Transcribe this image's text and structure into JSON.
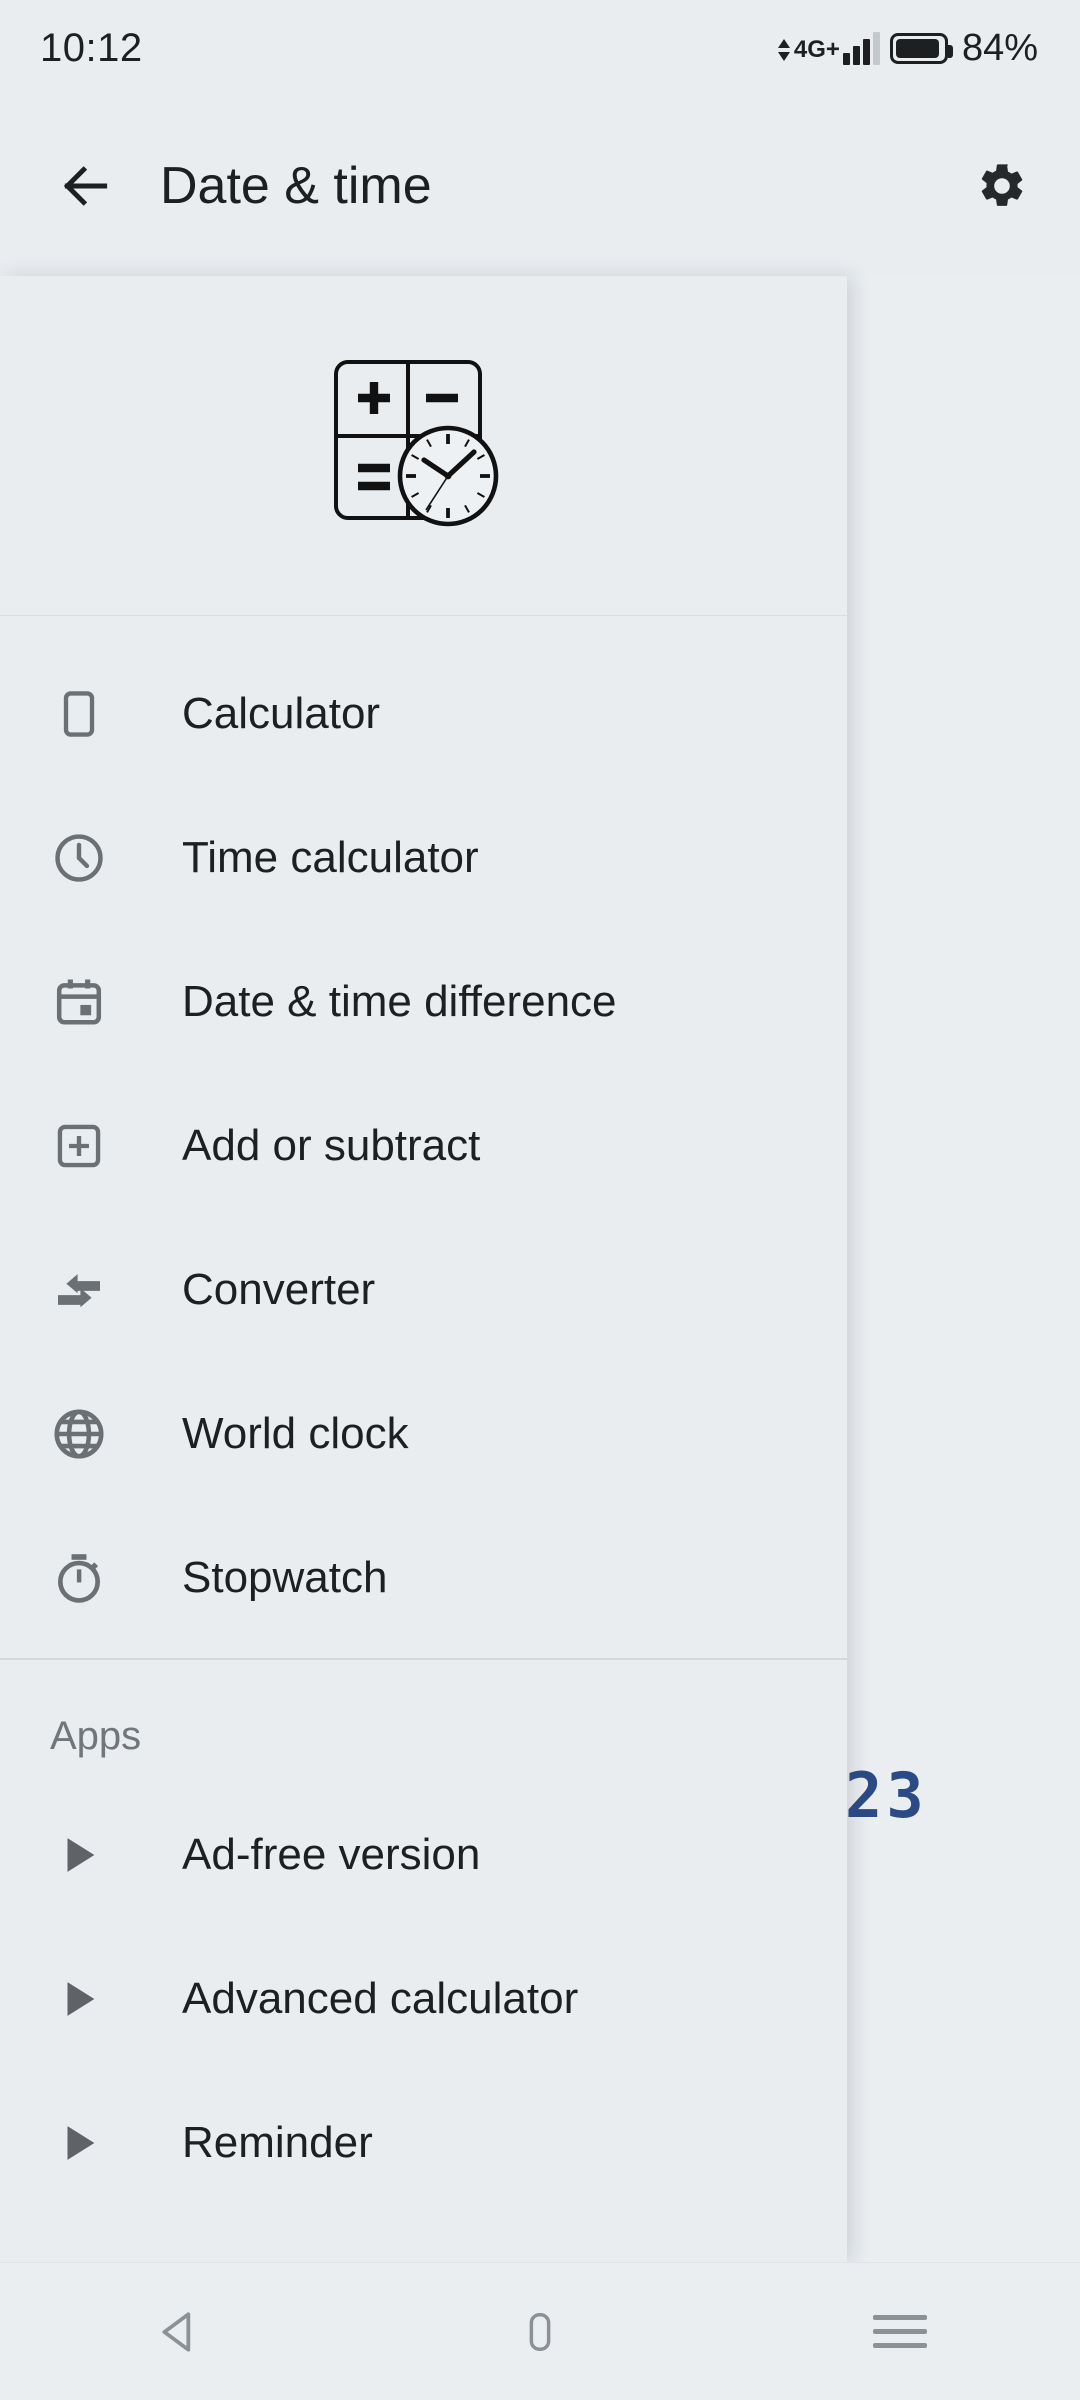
{
  "status_bar": {
    "clock": "10:12",
    "network_label": "4G+",
    "battery_percent": "84%",
    "battery_level": 84,
    "signal_bars": 3,
    "icons": [
      "data-updown-icon",
      "signal-bars-icon",
      "battery-icon"
    ]
  },
  "app_bar": {
    "back_icon": "arrow-left-icon",
    "title": "Date & time",
    "settings_icon": "gear-icon"
  },
  "drawer": {
    "logo_name": "calculator-clock-logo",
    "items": [
      {
        "label": "Calculator",
        "icon": "calculator-icon"
      },
      {
        "label": "Time calculator",
        "icon": "clock-icon"
      },
      {
        "label": "Date & time difference",
        "icon": "calendar-icon"
      },
      {
        "label": "Add or subtract",
        "icon": "plus-square-icon"
      },
      {
        "label": "Converter",
        "icon": "convert-arrows-icon"
      },
      {
        "label": "World clock",
        "icon": "globe-icon"
      },
      {
        "label": "Stopwatch",
        "icon": "stopwatch-icon"
      }
    ],
    "apps_section": {
      "header": "Apps",
      "items": [
        {
          "label": "Ad-free version",
          "icon": "play-triangle-icon"
        },
        {
          "label": "Advanced calculator",
          "icon": "play-triangle-icon"
        },
        {
          "label": "Reminder",
          "icon": "play-triangle-icon"
        }
      ]
    }
  },
  "background_screen": {
    "lcd_value": "23"
  },
  "system_nav": {
    "back_icon": "nav-back-triangle-icon",
    "home_icon": "nav-home-icon",
    "recents_icon": "nav-recents-icon"
  },
  "colors": {
    "background": "#e9edf0",
    "text_primary": "#1d1f21",
    "text_secondary": "#71767b",
    "icon_grey": "#6b7075",
    "lcd_blue": "#2b4a86",
    "divider": "#d3d8dd"
  }
}
